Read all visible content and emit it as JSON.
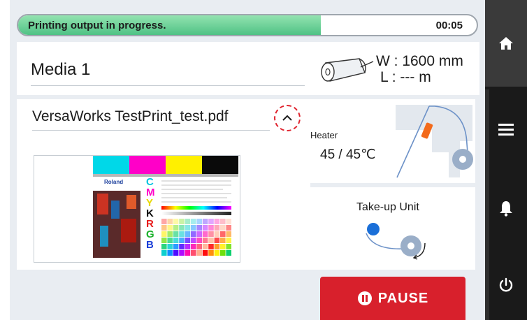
{
  "status": {
    "message": "Printing output in progress.",
    "elapsed": "00:05",
    "progress": 0.66,
    "fill_color": "#4fc285"
  },
  "media": {
    "name": "Media 1",
    "width_label": "W : 1600 mm",
    "length_label": "L : --- m"
  },
  "job": {
    "file_name": "VersaWorks TestPrint_test.pdf",
    "collapse_icon": "chevron-up-icon",
    "preview_color_letters": [
      "C",
      "M",
      "Y",
      "K",
      "R",
      "G",
      "B"
    ],
    "preview_brand": "Roland"
  },
  "heater": {
    "label": "Heater",
    "value": "45 / 45℃"
  },
  "takeup": {
    "label": "Take-up Unit"
  },
  "pause": {
    "label": "PAUSE",
    "color": "#d8202c"
  },
  "sidebar": {
    "items": [
      {
        "icon": "home-icon"
      },
      {
        "icon": "menu-icon"
      },
      {
        "icon": "bell-icon"
      },
      {
        "icon": "power-icon"
      }
    ]
  }
}
